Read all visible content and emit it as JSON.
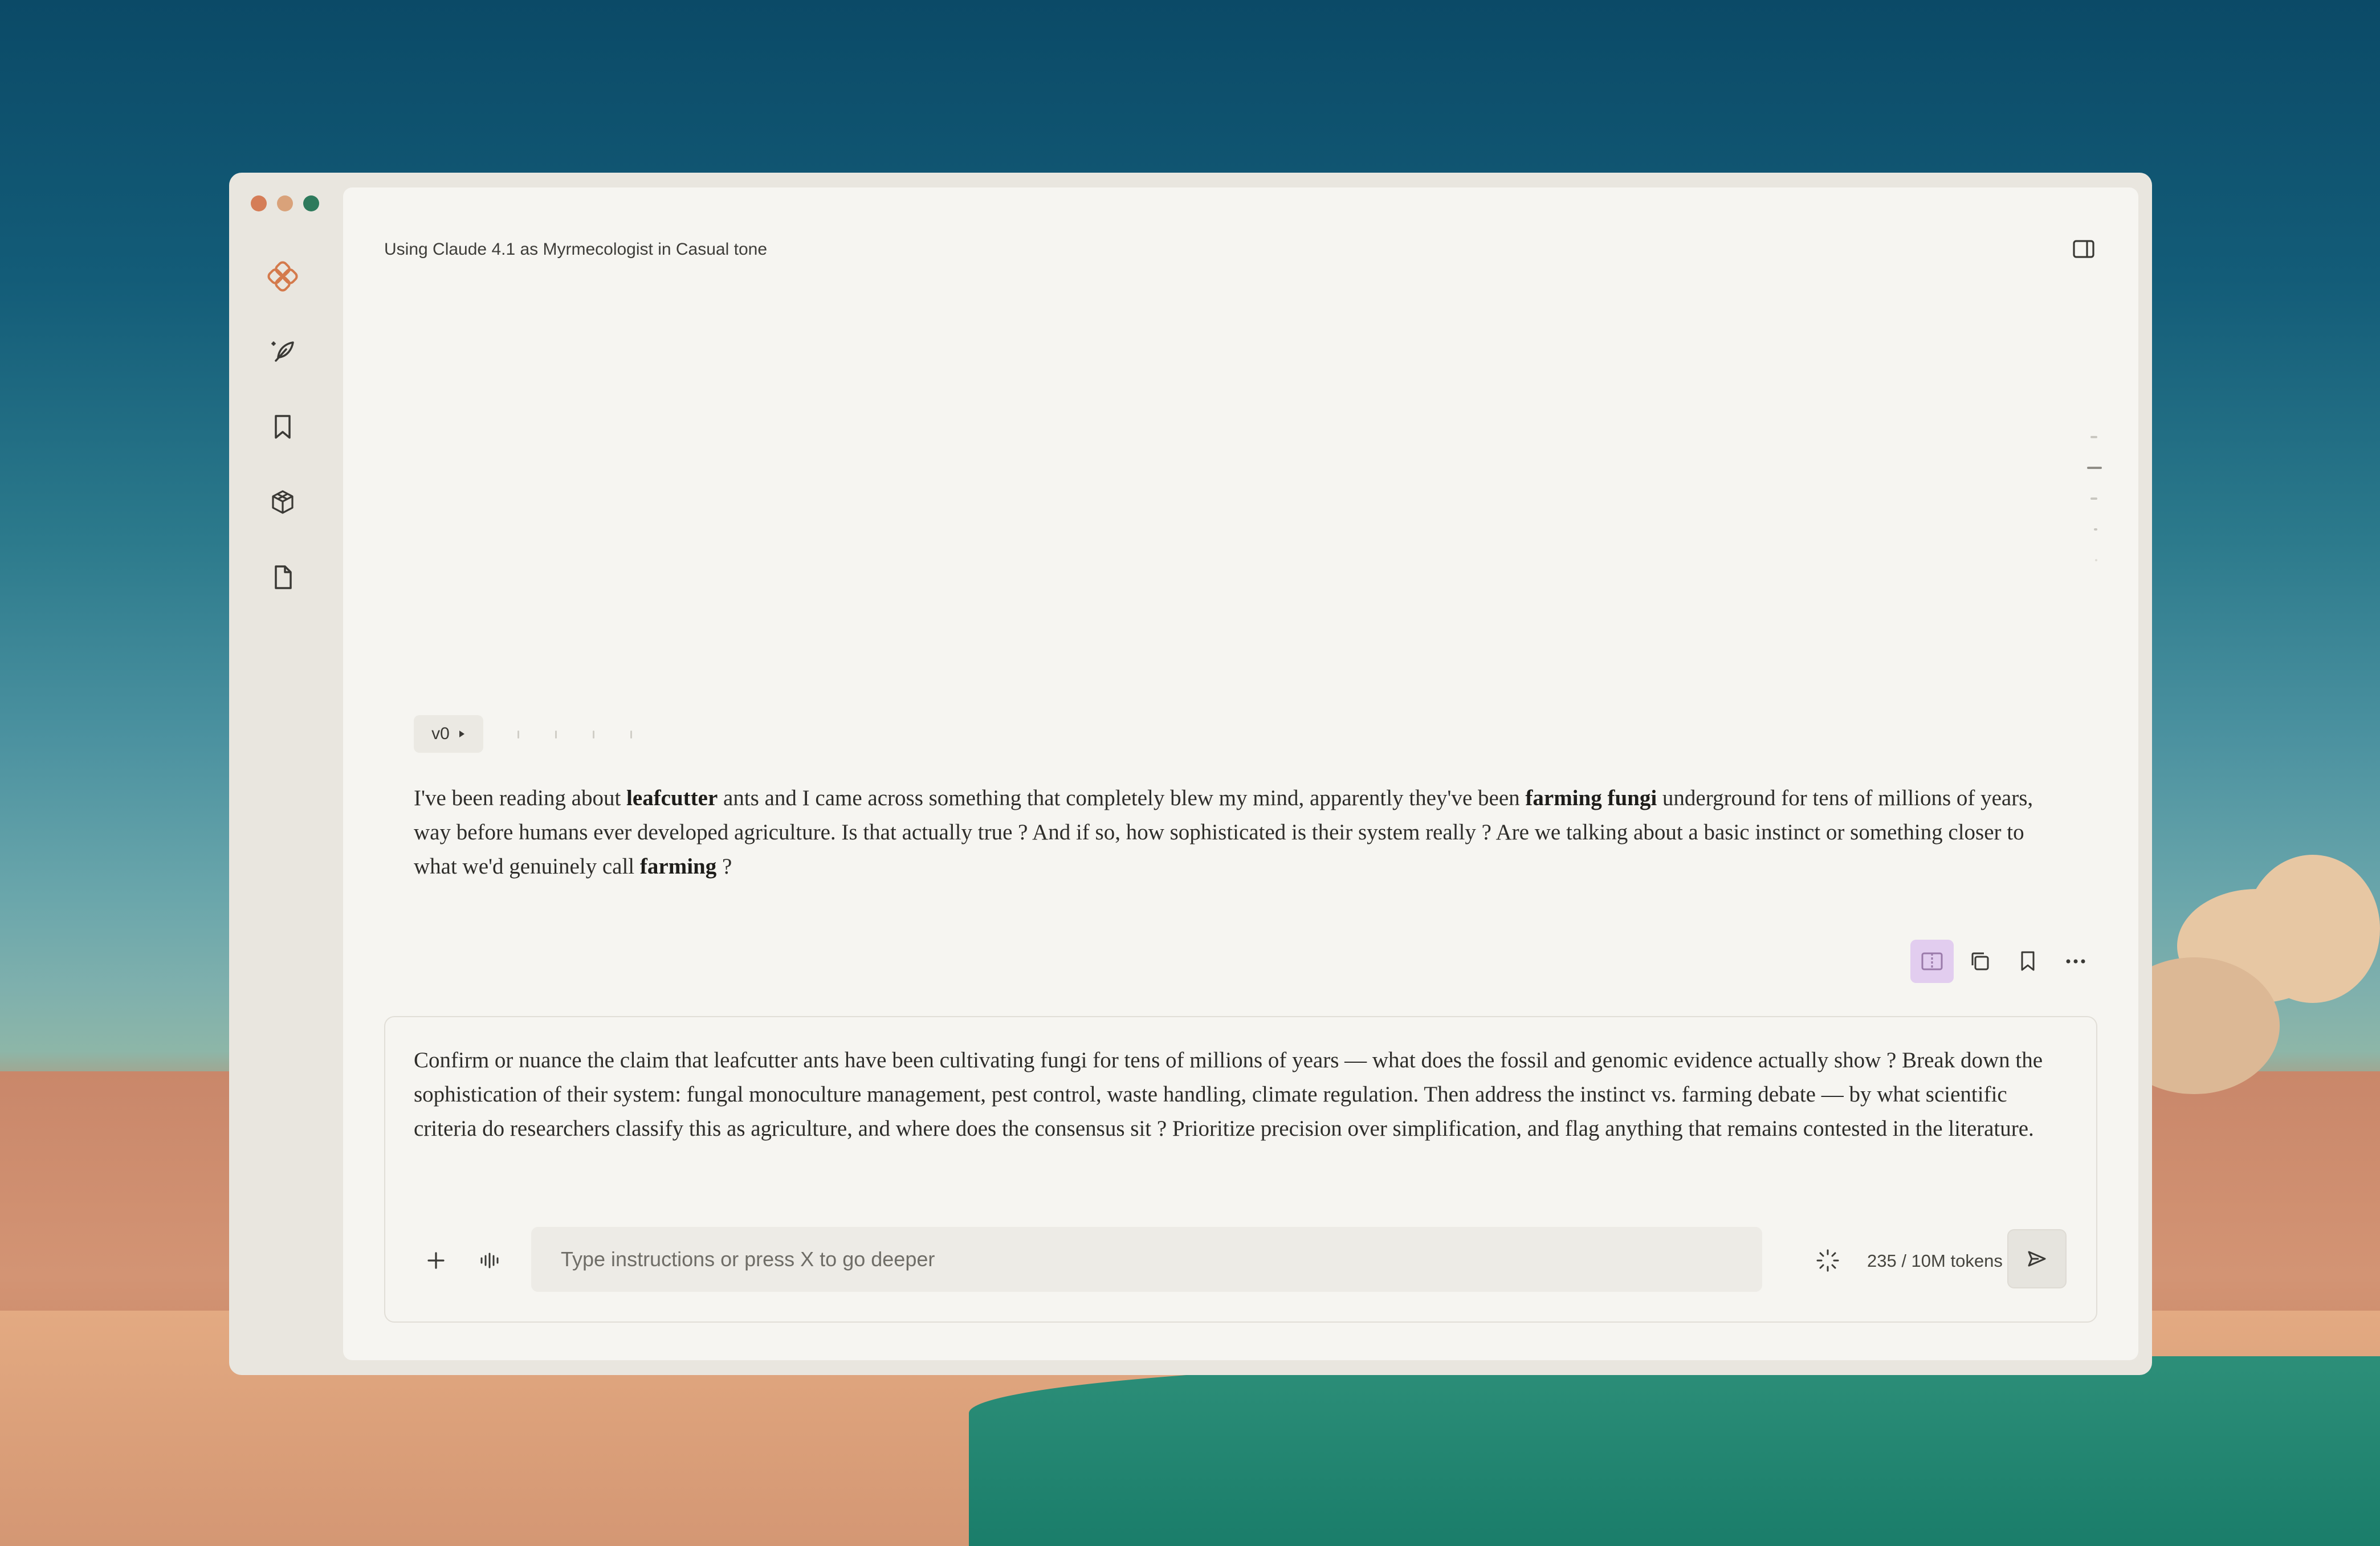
{
  "window": {
    "traffic_lights": {
      "close": "#d57d57",
      "minimize": "#d9a27a",
      "maximize": "#2e7a5c"
    }
  },
  "sidebar": {
    "items": [
      {
        "icon": "knot-logo-icon"
      },
      {
        "icon": "feather-pen-icon"
      },
      {
        "icon": "bookmark-icon"
      },
      {
        "icon": "cube-icon"
      },
      {
        "icon": "document-icon"
      }
    ],
    "accent": "#d47a4c"
  },
  "header": {
    "title": "Using Claude 4.1 as Myrmecologist in Casual tone",
    "toggle_icon": "sidebar-toggle-icon"
  },
  "version": {
    "label": "v0",
    "icon": "play-triangle-icon"
  },
  "message": {
    "segments": [
      {
        "text": "I've been reading about ",
        "bold": false
      },
      {
        "text": "leafcutter",
        "bold": true
      },
      {
        "text": " ants and I came across something that completely blew my mind, apparently they've been ",
        "bold": false
      },
      {
        "text": "farming fungi",
        "bold": true
      },
      {
        "text": " underground for tens of millions of years, way before humans ever developed agriculture. Is that actually true ? And if so, how sophisticated is their system really ? Are we talking about a basic instinct or something closer to what we'd genuinely call ",
        "bold": false
      },
      {
        "text": "farming",
        "bold": true
      },
      {
        "text": " ?",
        "bold": false
      }
    ]
  },
  "message_actions": [
    {
      "icon": "split-view-icon",
      "active": true,
      "active_color": "#e2cdef"
    },
    {
      "icon": "copy-icon",
      "active": false
    },
    {
      "icon": "bookmark-icon",
      "active": false
    },
    {
      "icon": "more-icon",
      "active": false
    }
  ],
  "composer": {
    "prompt_text": "Confirm or nuance the claim that leafcutter ants have been cultivating fungi for tens of millions of years — what does the fossil and genomic evidence actually show ? Break down the sophistication of their system: fungal monoculture management, pest control, waste handling, climate regulation. Then address the instinct vs. farming debate — by what scientific criteria do researchers classify this as agriculture, and where does the consensus sit ? Prioritize precision over simplification, and flag anything that remains contested in the literature.",
    "add_icon": "plus-icon",
    "voice_icon": "waveform-icon",
    "input_placeholder": "Type instructions or press X to go deeper",
    "input_value": "",
    "spinner_icon": "loading-spinner-icon",
    "tokens": "235 / 10M tokens",
    "send_icon": "send-icon"
  }
}
